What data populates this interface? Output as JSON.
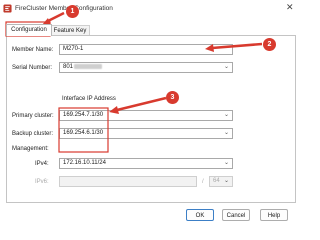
{
  "window": {
    "title": "FireCluster Member Configuration"
  },
  "tabs": [
    {
      "label": "Configuration",
      "active": true
    },
    {
      "label": "Feature Key",
      "active": false
    }
  ],
  "form": {
    "member_name_label": "Member Name:",
    "member_name_value": "M270-1",
    "serial_number_label": "Serial Number:",
    "serial_number_value": "801",
    "section_header": "Interface IP Address",
    "primary_cluster_label": "Primary cluster:",
    "primary_cluster_value": "169.254.7.1/30",
    "backup_cluster_label": "Backup cluster:",
    "backup_cluster_value": "169.254.6.1/30",
    "management_label": "Management:",
    "ipv4_label": "IPv4:",
    "ipv4_value": "172.16.10.11/24",
    "ipv6_label": "IPv6:",
    "ipv6_prefix_separator": "/",
    "ipv6_prefix_value": "64"
  },
  "buttons": {
    "ok": "OK",
    "cancel": "Cancel",
    "help": "Help"
  },
  "annotations": {
    "badge_1": "1",
    "badge_2": "2",
    "badge_3": "3",
    "color": "#d83a2e"
  }
}
